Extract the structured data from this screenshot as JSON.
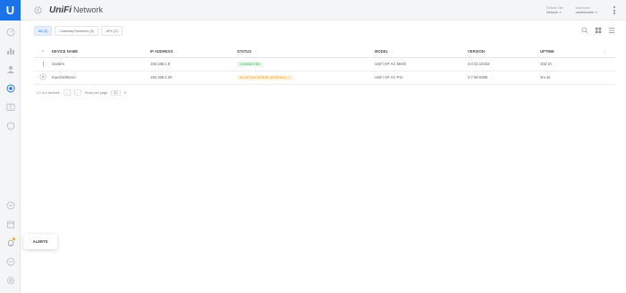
{
  "app": {
    "logo_letter": "U",
    "brand_unifi": "UniFi",
    "brand_network": "Network"
  },
  "header": {
    "blocks": [
      {
        "label": "Default Site",
        "value": "Network  ∨"
      },
      {
        "label": "Username",
        "value": "administrator  ∨"
      }
    ]
  },
  "tabs": [
    {
      "label": "All (2)",
      "active": true
    },
    {
      "label": "Gateway/Switches (0)",
      "active": false
    },
    {
      "label": "APs (2)",
      "active": false
    }
  ],
  "table": {
    "columns": [
      "DEVICE NAME",
      "IP ADDRESS",
      "STATUS",
      "MODEL",
      "VERSION",
      "UPTIME"
    ],
    "rows": [
      {
        "name": "Garden",
        "ip": "192.168.1.9",
        "status": "CONNECTED",
        "status_type": "ok",
        "model": "UniFi AP-AC Mesh",
        "version": "4.0.42.10433",
        "uptime": "10d 1h"
      },
      {
        "name": "Kueche/Buero",
        "ip": "192.168.1.20",
        "status": "ADOPTION ERROR (PENDING)  ⚠",
        "status_type": "warn",
        "model": "UniFi AP-AC-Pro",
        "version": "3.7.58.6385",
        "uptime": "3m 4s"
      }
    ]
  },
  "pager": {
    "range": "1-2 of 2 devices",
    "prev": "‹",
    "next": "›",
    "rows_label": "Rows per page",
    "rows_value": "50",
    "rows_caret": "∨"
  },
  "tooltip": {
    "text": "ALERTS"
  },
  "colors": {
    "accent": "#1a73e8",
    "ok": "#32a852",
    "warn": "#e89a20",
    "alert": "#f5a623"
  }
}
